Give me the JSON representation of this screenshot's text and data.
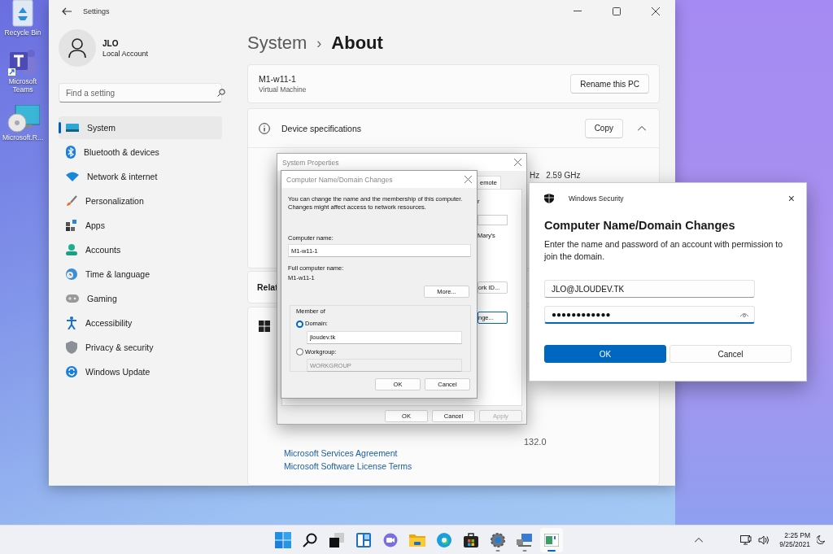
{
  "desktop_icons": [
    {
      "label": "Recycle Bin"
    },
    {
      "label": "Microsoft Teams"
    },
    {
      "label": "Microsoft.R..."
    }
  ],
  "settings": {
    "title": "Settings",
    "user": {
      "name": "JLO",
      "account": "Local Account"
    },
    "search": {
      "placeholder": "Find a setting"
    },
    "nav": [
      {
        "label": "System",
        "selected": true
      },
      {
        "label": "Bluetooth & devices",
        "selected": false
      },
      {
        "label": "Network & internet",
        "selected": false
      },
      {
        "label": "Personalization",
        "selected": false
      },
      {
        "label": "Apps",
        "selected": false
      },
      {
        "label": "Accounts",
        "selected": false
      },
      {
        "label": "Time & language",
        "selected": false
      },
      {
        "label": "Gaming",
        "selected": false
      },
      {
        "label": "Accessibility",
        "selected": false
      },
      {
        "label": "Privacy & security",
        "selected": false
      },
      {
        "label": "Windows Update",
        "selected": false
      }
    ],
    "breadcrumb": {
      "parent": "System",
      "separator": "›",
      "current": "About"
    },
    "pc": {
      "name": "M1-w11-1",
      "model": "Virtual Machine",
      "rename": "Rename this PC"
    },
    "specs": {
      "title": "Device specifications",
      "copy": "Copy",
      "expanded": true,
      "fragments": [
        "Hz",
        "2.59 GHz"
      ]
    },
    "related_fragment": "Relat",
    "windows_specs": {
      "fragment": "132.0",
      "links": [
        "Microsoft Services Agreement",
        "Microsoft Software License Terms"
      ]
    }
  },
  "system_properties": {
    "title": "System Properties",
    "tab_fragment": "emote",
    "text_fragments": [
      "r",
      "Mary's"
    ],
    "side_buttons": [
      {
        "label": "ork ID...",
        "focused": false
      },
      {
        "label": "nge...",
        "focused": true
      }
    ],
    "buttons": [
      {
        "label": "OK",
        "disabled": false
      },
      {
        "label": "Cancel",
        "disabled": false
      },
      {
        "label": "Apply",
        "disabled": true
      }
    ]
  },
  "name_dialog": {
    "title": "Computer Name/Domain Changes",
    "intro": "You can change the name and the membership of this computer. Changes might affect access to network resources.",
    "name_label": "Computer name:",
    "name_value": "M1-w11-1",
    "full_label": "Full computer name:",
    "full_value": "M1-w11-1",
    "more": "More...",
    "group_label": "Member of",
    "options": [
      {
        "label": "Domain:",
        "selected": true,
        "value": "jloudev.tk"
      },
      {
        "label": "Workgroup:",
        "selected": false,
        "value": "WORKGROUP"
      }
    ],
    "buttons": [
      "OK",
      "Cancel"
    ]
  },
  "security": {
    "app": "Windows Security",
    "close": "×",
    "heading": "Computer Name/Domain Changes",
    "message": "Enter the name and password of an account with permission to join the domain.",
    "username": "JLO@JLOUDEV.TK",
    "password": "●●●●●●●●●●●●",
    "ok": "OK",
    "cancel": "Cancel"
  },
  "taskbar": {
    "apps": [
      {
        "running": false,
        "selected": false
      },
      {
        "running": false,
        "selected": false
      },
      {
        "running": false,
        "selected": false
      },
      {
        "running": false,
        "selected": false
      },
      {
        "running": false,
        "selected": false
      },
      {
        "running": false,
        "selected": false
      },
      {
        "running": false,
        "selected": false
      },
      {
        "running": false,
        "selected": false
      },
      {
        "running": true,
        "selected": false
      },
      {
        "running": true,
        "selected": false
      },
      {
        "running": true,
        "selected": true
      }
    ],
    "time": "2:25 PM",
    "date": "9/25/2021"
  }
}
